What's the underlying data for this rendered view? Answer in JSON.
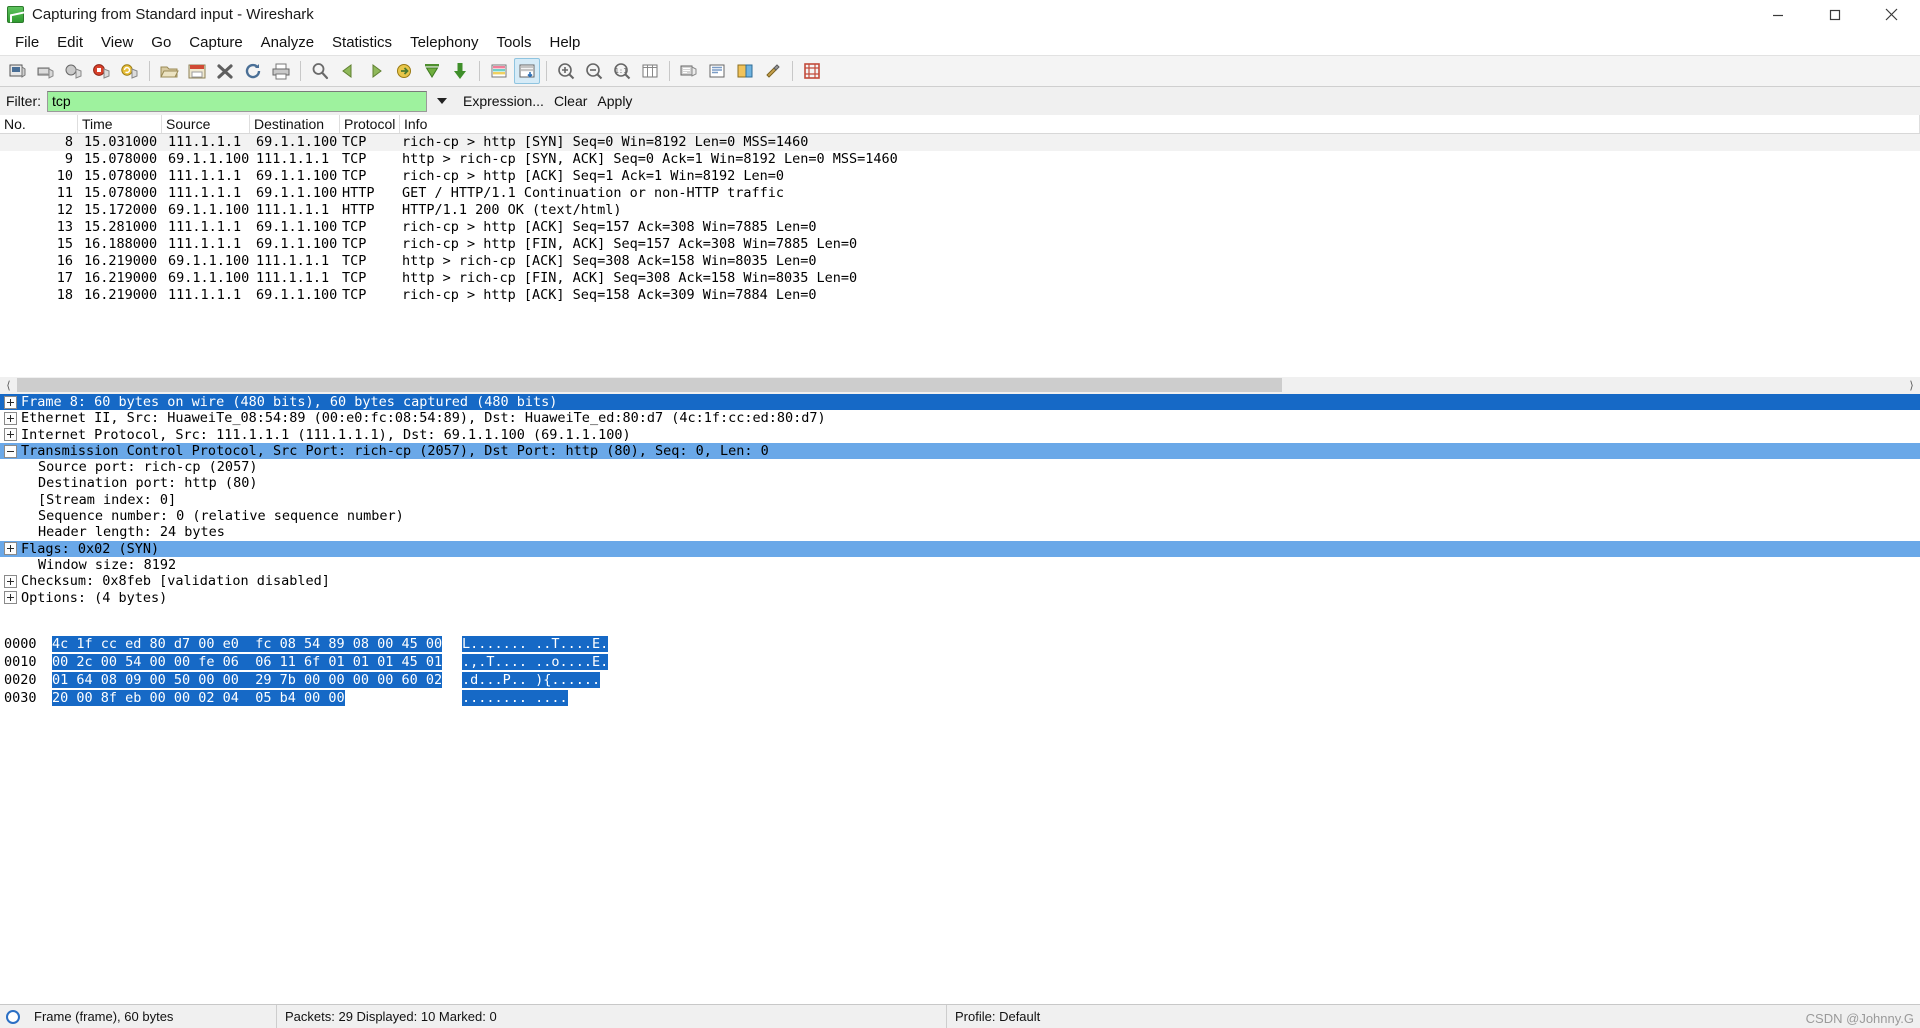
{
  "window": {
    "title": "Capturing from Standard input - Wireshark",
    "app_icon": "wireshark-fin-icon",
    "minimize_label": "Minimize",
    "maximize_label": "Maximize",
    "close_label": "Close"
  },
  "menu": [
    {
      "label": "File",
      "accel": "F"
    },
    {
      "label": "Edit",
      "accel": "E"
    },
    {
      "label": "View",
      "accel": "V"
    },
    {
      "label": "Go",
      "accel": "G"
    },
    {
      "label": "Capture",
      "accel": "C"
    },
    {
      "label": "Analyze",
      "accel": "A"
    },
    {
      "label": "Statistics",
      "accel": "S"
    },
    {
      "label": "Telephony",
      "accel": "T"
    },
    {
      "label": "Tools",
      "accel": "T"
    },
    {
      "label": "Help",
      "accel": "H"
    }
  ],
  "toolbar": {
    "groups": [
      [
        {
          "icon": "interfaces-icon",
          "tip": "List the available capture interfaces"
        },
        {
          "icon": "capture-options-icon",
          "tip": "Show the capture options"
        },
        {
          "icon": "start-capture-icon",
          "tip": "Start a new live capture"
        },
        {
          "icon": "stop-capture-icon",
          "tip": "Stop the running live capture"
        },
        {
          "icon": "restart-capture-icon",
          "tip": "Restart the running live capture"
        }
      ],
      [
        {
          "icon": "open-file-icon",
          "tip": "Open a capture file"
        },
        {
          "icon": "save-file-icon",
          "tip": "Save this capture file"
        },
        {
          "icon": "close-file-icon",
          "tip": "Close this capture file"
        },
        {
          "icon": "reload-icon",
          "tip": "Reload this capture file"
        },
        {
          "icon": "print-icon",
          "tip": "Print packets"
        }
      ],
      [
        {
          "icon": "find-packet-icon",
          "tip": "Find a packet"
        },
        {
          "icon": "go-back-icon",
          "tip": "Go back in packet history"
        },
        {
          "icon": "go-forward-icon",
          "tip": "Go forward in packet history"
        },
        {
          "icon": "go-to-packet-icon",
          "tip": "Go to a specific packet"
        },
        {
          "icon": "go-to-first-icon",
          "tip": "Go to the first packet"
        },
        {
          "icon": "go-to-last-icon",
          "tip": "Go to the last packet"
        }
      ],
      [
        {
          "icon": "colorize-icon",
          "tip": "Colorize packet list"
        },
        {
          "icon": "auto-scroll-icon",
          "tip": "Auto scroll in live capture",
          "active": true
        }
      ],
      [
        {
          "icon": "zoom-in-icon",
          "tip": "Zoom in"
        },
        {
          "icon": "zoom-out-icon",
          "tip": "Zoom out"
        },
        {
          "icon": "zoom-reset-icon",
          "tip": "Return zoom level to 100%"
        },
        {
          "icon": "resize-columns-icon",
          "tip": "Resize columns to fit contents"
        }
      ],
      [
        {
          "icon": "capture-filters-icon",
          "tip": "Edit capture filters"
        },
        {
          "icon": "display-filters-icon",
          "tip": "Edit display filters"
        },
        {
          "icon": "coloring-rules-icon",
          "tip": "Edit coloring rules"
        },
        {
          "icon": "preferences-icon",
          "tip": "Edit preferences"
        }
      ],
      [
        {
          "icon": "help-contents-icon",
          "tip": "Show help contents"
        }
      ]
    ]
  },
  "filter_bar": {
    "label": "Filter:",
    "value": "tcp",
    "placeholder": "",
    "dropdown_icon": "chevron-down-icon",
    "expression_label": "Expression...",
    "clear_label": "Clear",
    "apply_label": "Apply"
  },
  "packet_list": {
    "columns": [
      "No.",
      "Time",
      "Source",
      "Destination",
      "Protocol",
      "Info"
    ],
    "rows": [
      {
        "no": "8",
        "time": "15.031000",
        "src": "111.1.1.1",
        "dst": "69.1.1.100",
        "proto": "TCP",
        "info": "rich-cp > http [SYN] Seq=0 Win=8192 Len=0 MSS=1460",
        "selected": true
      },
      {
        "no": "9",
        "time": "15.078000",
        "src": "69.1.1.100",
        "dst": "111.1.1.1",
        "proto": "TCP",
        "info": "http > rich-cp [SYN, ACK] Seq=0 Ack=1 Win=8192 Len=0 MSS=1460"
      },
      {
        "no": "10",
        "time": "15.078000",
        "src": "111.1.1.1",
        "dst": "69.1.1.100",
        "proto": "TCP",
        "info": "rich-cp > http [ACK] Seq=1 Ack=1 Win=8192 Len=0"
      },
      {
        "no": "11",
        "time": "15.078000",
        "src": "111.1.1.1",
        "dst": "69.1.1.100",
        "proto": "HTTP",
        "info": "GET / HTTP/1.1 Continuation or non-HTTP traffic"
      },
      {
        "no": "12",
        "time": "15.172000",
        "src": "69.1.1.100",
        "dst": "111.1.1.1",
        "proto": "HTTP",
        "info": "HTTP/1.1 200 OK  (text/html)"
      },
      {
        "no": "13",
        "time": "15.281000",
        "src": "111.1.1.1",
        "dst": "69.1.1.100",
        "proto": "TCP",
        "info": "rich-cp > http [ACK] Seq=157 Ack=308 Win=7885 Len=0"
      },
      {
        "no": "15",
        "time": "16.188000",
        "src": "111.1.1.1",
        "dst": "69.1.1.100",
        "proto": "TCP",
        "info": "rich-cp > http [FIN, ACK] Seq=157 Ack=308 Win=7885 Len=0"
      },
      {
        "no": "16",
        "time": "16.219000",
        "src": "69.1.1.100",
        "dst": "111.1.1.1",
        "proto": "TCP",
        "info": "http > rich-cp [ACK] Seq=308 Ack=158 Win=8035 Len=0"
      },
      {
        "no": "17",
        "time": "16.219000",
        "src": "69.1.1.100",
        "dst": "111.1.1.1",
        "proto": "TCP",
        "info": "http > rich-cp [FIN, ACK] Seq=308 Ack=158 Win=8035 Len=0"
      },
      {
        "no": "18",
        "time": "16.219000",
        "src": "111.1.1.1",
        "dst": "69.1.1.100",
        "proto": "TCP",
        "info": "rich-cp > http [ACK] Seq=158 Ack=309 Win=7884 Len=0"
      }
    ]
  },
  "detail_tree": [
    {
      "text": "Frame 8: 60 bytes on wire (480 bits), 60 bytes captured (480 bits)",
      "twisty": "plus",
      "indent": 0,
      "state": "selected-dark"
    },
    {
      "text": "Ethernet II, Src: HuaweiTe_08:54:89 (00:e0:fc:08:54:89), Dst: HuaweiTe_ed:80:d7 (4c:1f:cc:ed:80:d7)",
      "twisty": "plus",
      "indent": 0,
      "state": "normal"
    },
    {
      "text": "Internet Protocol, Src: 111.1.1.1 (111.1.1.1), Dst: 69.1.1.100 (69.1.1.100)",
      "twisty": "plus",
      "indent": 0,
      "state": "normal"
    },
    {
      "text": "Transmission Control Protocol, Src Port: rich-cp (2057), Dst Port: http (80), Seq: 0, Len: 0",
      "twisty": "minus",
      "indent": 0,
      "state": "selected-light"
    },
    {
      "text": "Source port: rich-cp (2057)",
      "twisty": "none",
      "indent": 1,
      "state": "normal"
    },
    {
      "text": "Destination port: http (80)",
      "twisty": "none",
      "indent": 1,
      "state": "normal"
    },
    {
      "text": "[Stream index: 0]",
      "twisty": "none",
      "indent": 1,
      "state": "normal"
    },
    {
      "text": "Sequence number: 0    (relative sequence number)",
      "twisty": "none",
      "indent": 1,
      "state": "normal"
    },
    {
      "text": "Header length: 24 bytes",
      "twisty": "none",
      "indent": 1,
      "state": "normal"
    },
    {
      "text": "Flags: 0x02 (SYN)",
      "twisty": "plus",
      "indent": 0,
      "state": "selected-light"
    },
    {
      "text": "Window size: 8192",
      "twisty": "none",
      "indent": 1,
      "state": "normal"
    },
    {
      "text": "Checksum: 0x8feb [validation disabled]",
      "twisty": "plus",
      "indent": 0,
      "state": "normal"
    },
    {
      "text": "Options: (4 bytes)",
      "twisty": "plus",
      "indent": 0,
      "state": "normal"
    }
  ],
  "hex_dump": [
    {
      "offset": "0000",
      "bytes_hl": "4c 1f cc ed 80 d7 00 e0  fc 08 54 89 08 00 45 00",
      "bytes_plain": "",
      "ascii_hl": "L....... ..T....E.",
      "ascii_plain": ""
    },
    {
      "offset": "0010",
      "bytes_hl": "00 2c 00 54 00 00 fe 06  06 11 6f 01 01 01 45 01",
      "bytes_plain": "",
      "ascii_hl": ".,.T.... ..o....E.",
      "ascii_plain": ""
    },
    {
      "offset": "0020",
      "bytes_hl": "01 64 08 09 00 50 00 00  29 7b 00 00 00 00 60 02",
      "bytes_plain": "",
      "ascii_hl": ".d...P.. ){......",
      "ascii_plain": ""
    },
    {
      "offset": "0030",
      "bytes_hl": "20 00 8f eb 00 00 02 04  05 b4 00 00",
      "bytes_plain": "",
      "ascii_hl": "........ ....",
      "ascii_plain": ""
    }
  ],
  "status_bar": {
    "icon": "capture-status-icon",
    "left": "Frame (frame), 60 bytes",
    "middle": "Packets: 29 Displayed: 10 Marked: 0",
    "right": "Profile: Default"
  },
  "watermark": "CSDN @Johnny.G",
  "colors": {
    "selection_dark": "#1669c6",
    "selection_light": "#6aa8e8",
    "filter_valid_bg": "#9ef29e",
    "toolbar_active": "#d6ebf7"
  }
}
